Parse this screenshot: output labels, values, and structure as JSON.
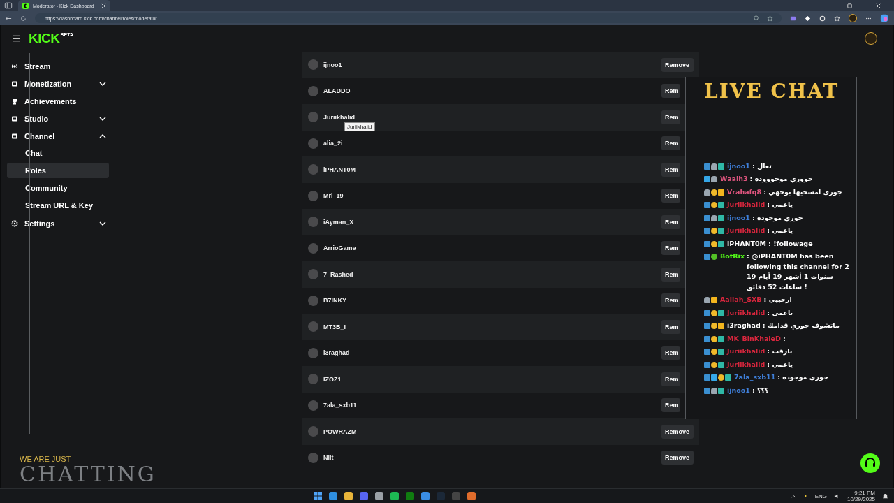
{
  "browser": {
    "tab_title": "Moderator - Kick Dashboard",
    "url": "https://dashboard.kick.com/channel/roles/moderator"
  },
  "header": {
    "logo": "KICK",
    "logo_badge": "BETA"
  },
  "sidebar": {
    "items": [
      {
        "label": "Stream"
      },
      {
        "label": "Monetization",
        "expanded": false
      },
      {
        "label": "Achievements"
      },
      {
        "label": "Studio",
        "expanded": false
      },
      {
        "label": "Channel",
        "expanded": true,
        "children": [
          {
            "label": "Chat",
            "selected": false
          },
          {
            "label": "Roles",
            "selected": true
          },
          {
            "label": "Community",
            "selected": false
          },
          {
            "label": "Stream URL & Key",
            "selected": false
          }
        ]
      },
      {
        "label": "Settings",
        "expanded": false
      }
    ]
  },
  "moderators": [
    {
      "name": "ijnoo1",
      "button": "Remove"
    },
    {
      "name": "ALADDO",
      "button": "Rem"
    },
    {
      "name": "Juriikhalid",
      "button": "Rem",
      "tooltip": "Juriikhalid"
    },
    {
      "name": "alia_2i",
      "button": "Rem"
    },
    {
      "name": "iPHANT0M",
      "button": "Rem"
    },
    {
      "name": "Mrl_19",
      "button": "Rem"
    },
    {
      "name": "iAyman_X",
      "button": "Rem"
    },
    {
      "name": "ArrioGame",
      "button": "Rem"
    },
    {
      "name": "7_Rashed",
      "button": "Rem"
    },
    {
      "name": "B7INKY",
      "button": "Rem"
    },
    {
      "name": "MT3B_I",
      "button": "Rem"
    },
    {
      "name": "i3raghad",
      "button": "Rem"
    },
    {
      "name": "IZOZ1",
      "button": "Rem"
    },
    {
      "name": "7ala_sxb11",
      "button": "Rem"
    },
    {
      "name": "POWRAZM",
      "button": "Remove"
    },
    {
      "name": "Nllt",
      "button": "Remove"
    }
  ],
  "chat_overlay": {
    "title": "LIVE CHAT",
    "messages": [
      {
        "badges": [
          {
            "kind": "mod"
          },
          {
            "kind": "sub"
          },
          {
            "kind": "og"
          }
        ],
        "user": "ijnoo1",
        "color": "#3f7fd9",
        "text": ": تعال"
      },
      {
        "badges": [
          {
            "kind": "cube"
          },
          {
            "kind": "sub"
          }
        ],
        "user": "Waalh3",
        "color": "#e0557f",
        "text": ": جووري موجوووده"
      },
      {
        "badges": [
          {
            "kind": "sub"
          },
          {
            "kind": "gift"
          },
          {
            "kind": "vip"
          }
        ],
        "user": "Vrahafq8",
        "color": "#e0557f",
        "text": ": جوري امسحيها بوجهي"
      },
      {
        "badges": [
          {
            "kind": "mod"
          },
          {
            "kind": "gift"
          },
          {
            "kind": "og"
          }
        ],
        "user": "Juriikhalid",
        "color": "#d7263d",
        "text": ": ياعمي"
      },
      {
        "badges": [
          {
            "kind": "mod"
          },
          {
            "kind": "sub"
          },
          {
            "kind": "og"
          }
        ],
        "user": "ijnoo1",
        "color": "#3f7fd9",
        "text": ": جوري موجوده"
      },
      {
        "badges": [
          {
            "kind": "mod"
          },
          {
            "kind": "gift"
          },
          {
            "kind": "og"
          }
        ],
        "user": "Juriikhalid",
        "color": "#d7263d",
        "text": ": ياعمي"
      },
      {
        "badges": [
          {
            "kind": "mod"
          },
          {
            "kind": "gift"
          },
          {
            "kind": "og"
          }
        ],
        "user": "iPHANT0M",
        "color": "#ffffff",
        "text": ": !followage"
      },
      {
        "badges": [
          {
            "kind": "mod"
          },
          {
            "kind": "verified"
          }
        ],
        "user": "BotRix",
        "color": "#53fc18",
        "text": ": @iPHANT0M has been following this channel for 2 سنوات 1 أشهر 19 أيام 19 ساعات 52 دقائق !"
      },
      {
        "badges": [
          {
            "kind": "sub"
          },
          {
            "kind": "vip"
          }
        ],
        "user": "Aaliah_SXB",
        "color": "#d7263d",
        "text": ": ارحبيي"
      },
      {
        "badges": [
          {
            "kind": "mod"
          },
          {
            "kind": "gift"
          },
          {
            "kind": "og"
          }
        ],
        "user": "Juriikhalid",
        "color": "#d7263d",
        "text": ": ياعمي"
      },
      {
        "badges": [
          {
            "kind": "mod"
          },
          {
            "kind": "gift"
          },
          {
            "kind": "vip"
          }
        ],
        "user": "i3raghad",
        "color": "#ffffff",
        "text": ": ماتشوف جوري قدامك"
      },
      {
        "badges": [
          {
            "kind": "mod"
          },
          {
            "kind": "gift"
          },
          {
            "kind": "og"
          }
        ],
        "user": "MK_BinKhaleD",
        "color": "#d7263d",
        "text": ":"
      },
      {
        "badges": [
          {
            "kind": "mod"
          },
          {
            "kind": "gift"
          },
          {
            "kind": "og"
          }
        ],
        "user": "Juriikhalid",
        "color": "#d7263d",
        "text": ": بازقت"
      },
      {
        "badges": [
          {
            "kind": "mod"
          },
          {
            "kind": "gift"
          },
          {
            "kind": "og"
          }
        ],
        "user": "Juriikhalid",
        "color": "#d7263d",
        "text": ": ياعمي"
      },
      {
        "badges": [
          {
            "kind": "mod"
          },
          {
            "kind": "cube"
          },
          {
            "kind": "gift"
          },
          {
            "kind": "og"
          }
        ],
        "user": "7ala_sxb11",
        "color": "#3f7fd9",
        "text": ": جوري موجوده"
      },
      {
        "badges": [
          {
            "kind": "mod"
          },
          {
            "kind": "sub"
          },
          {
            "kind": "og"
          }
        ],
        "user": "ijnoo1",
        "color": "#3f7fd9",
        "text": ": ؟؟؟"
      }
    ]
  },
  "stream_overlay": {
    "tagline": "WE ARE JUST",
    "title": "CHATTING"
  },
  "taskbar": {
    "language": "ENG",
    "time": "9:21 PM",
    "date": "10/29/2025"
  }
}
